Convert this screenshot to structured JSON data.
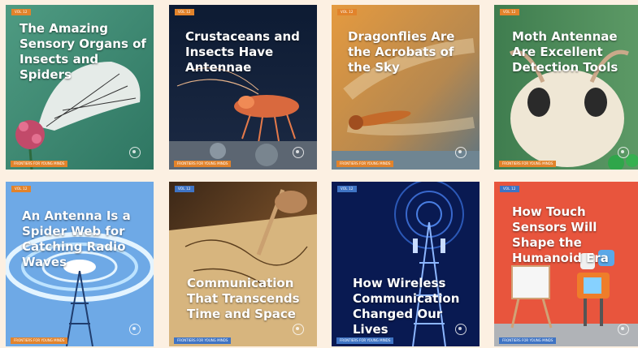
{
  "colors": {
    "page_bg": "#fcf0e2",
    "badge_orange": "#e2832b",
    "badge_blue": "#3f74c4"
  },
  "cards": [
    {
      "badge": "VOL 12",
      "title": "The Amazing Sensory Organs of Insects and Spiders",
      "footer": "FRONTIERS FOR YOUNG MINDS",
      "badge_color": "#e2832b"
    },
    {
      "badge": "VOL 12",
      "title": "Crustaceans and Insects Have Antennae",
      "footer": "FRONTIERS FOR YOUNG MINDS",
      "badge_color": "#e2832b"
    },
    {
      "badge": "VOL 12",
      "title": "Dragonflies Are the Acrobats of the Sky",
      "footer": "FRONTIERS FOR YOUNG MINDS",
      "badge_color": "#e2832b"
    },
    {
      "badge": "VOL 12",
      "title": "Moth Antennae Are Excellent Detection Tools",
      "footer": "FRONTIERS FOR YOUNG MINDS",
      "badge_color": "#e2832b"
    },
    {
      "badge": "VOL 12",
      "title": "An Antenna Is a Spider Web for Catching Radio Waves",
      "footer": "FRONTIERS FOR YOUNG MINDS",
      "badge_color": "#e2832b"
    },
    {
      "badge": "VOL 12",
      "title": "Communication That Transcends Time and Space",
      "footer": "FRONTIERS FOR YOUNG MINDS",
      "badge_color": "#3f74c4"
    },
    {
      "badge": "VOL 12",
      "title": "How Wireless Communication Changed Our Lives",
      "footer": "FRONTIERS FOR YOUNG MINDS",
      "badge_color": "#3f74c4"
    },
    {
      "badge": "VOL 12",
      "title": "How Touch Sensors Will Shape the Humanoid Era",
      "footer": "FRONTIERS FOR YOUNG MINDS",
      "badge_color": "#3f74c4"
    }
  ]
}
